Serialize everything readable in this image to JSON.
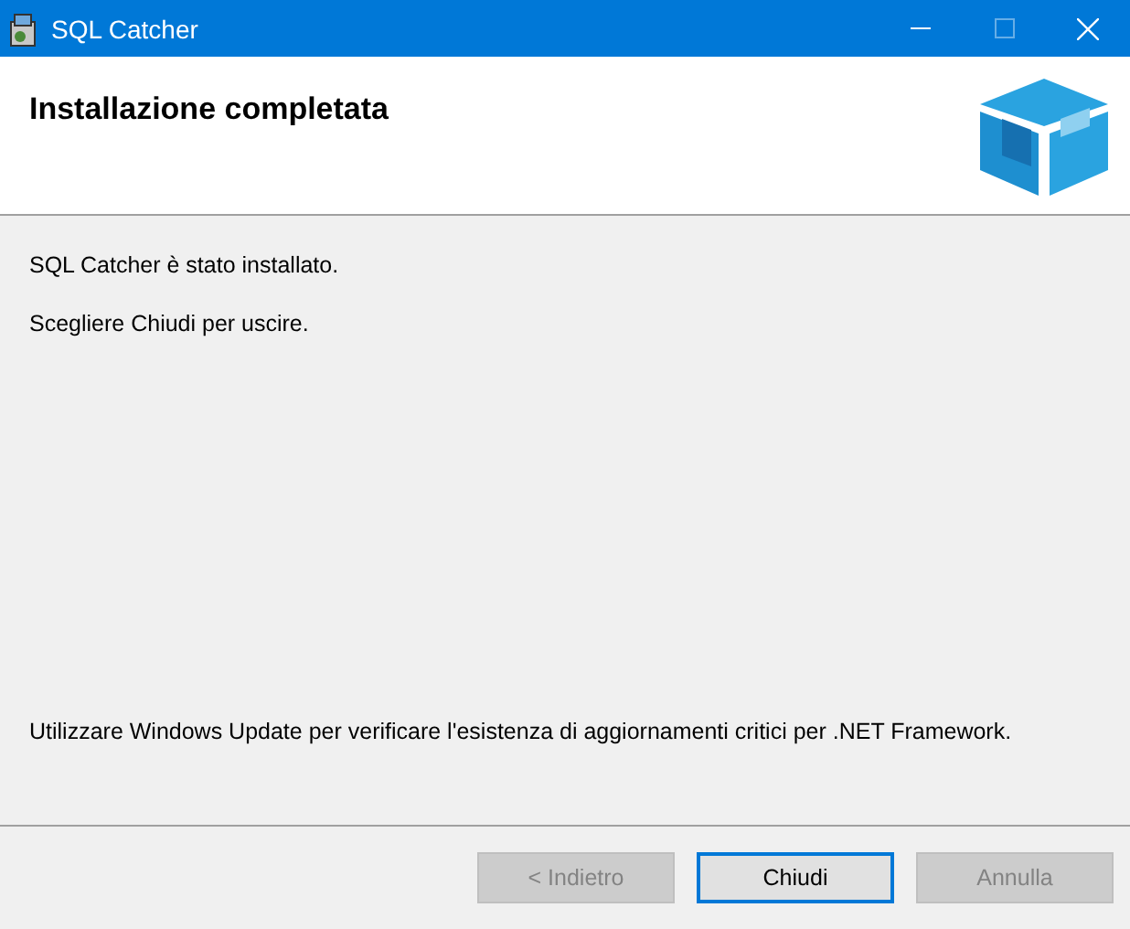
{
  "window": {
    "title": "SQL Catcher",
    "controls": [
      {
        "kind": "minimize",
        "disabled": false
      },
      {
        "kind": "maximize",
        "disabled": true
      },
      {
        "kind": "close",
        "disabled": false
      }
    ]
  },
  "header": {
    "title": "Installazione completata"
  },
  "messages": [
    "SQL Catcher è stato installato.",
    "Scegliere Chiudi per uscire."
  ],
  "footnote": "Utilizzare Windows Update per verificare l'esistenza di aggiornamenti critici per .NET Framework.",
  "buttons": [
    {
      "label": "< Indietro",
      "disabled": true,
      "default": false
    },
    {
      "label": "Chiudi",
      "disabled": false,
      "default": true
    },
    {
      "label": "Annulla",
      "disabled": true,
      "default": false
    }
  ]
}
